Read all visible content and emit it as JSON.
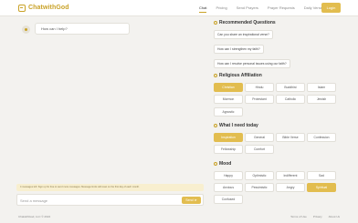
{
  "nav": {
    "brand": "ChatwithGod",
    "links": [
      "Chat",
      "Pricing",
      "Send Prayers",
      "Prayer Requests",
      "Daily Verse"
    ],
    "login": "Login"
  },
  "chat": {
    "greeting": "How can I help?",
    "notice": "4 messages left. Sign up for free to send more messages. Message limits will reset on the first day of each month.",
    "input_placeholder": "Send a message",
    "send_label": "Send"
  },
  "footer": {
    "copyright": "ChatwithGod, LLC © 2024",
    "links": [
      "Terms of Use",
      "Privacy",
      "About Us"
    ]
  },
  "panel": {
    "questions_title": "Recommended Questions",
    "questions": [
      "Can you share an inspirational verse?",
      "How can I strengthen my faith?",
      "How can I resolve personal issues using our faith?"
    ],
    "religion_title": "Religious Affiliation",
    "religions": [
      "Christian",
      "Hindu",
      "Buddhist",
      "Islam",
      "Mormon",
      "Protestant",
      "Catholic",
      "Jewish",
      "Agnostic"
    ],
    "religion_selected": "Christian",
    "need_title": "What I need today",
    "needs": [
      "Inspiration",
      "General",
      "Bible Verse",
      "Confession",
      "Fellowship",
      "Comfort"
    ],
    "need_selected": "Inspiration",
    "mood_title": "Mood",
    "moods": [
      "Happy",
      "Optimistic",
      "Indifferent",
      "Sad",
      "Anxious",
      "Pessimistic",
      "Angry",
      "Spiritual",
      "Confused"
    ],
    "mood_selected": "Spiritual"
  },
  "colors": {
    "accent": "#e2bd4f",
    "brand": "#c9a227",
    "background": "#f3f2ef"
  }
}
